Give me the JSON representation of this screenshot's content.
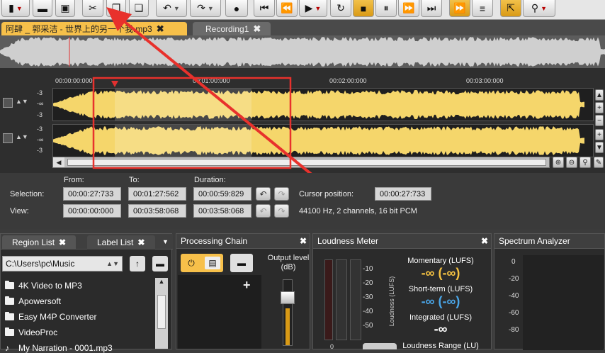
{
  "tabs": [
    {
      "label": "阿肆 _ 郭采洁 - 世界上的另一个我.mp3"
    },
    {
      "label": "Recording1"
    }
  ],
  "ruler": [
    "00:00:00:000",
    "00:01:00:000",
    "00:02:00:000",
    "00:03:00:000"
  ],
  "channel_db": [
    "-3",
    "-∞",
    "-3"
  ],
  "selection_panel": {
    "from_label": "From:",
    "to_label": "To:",
    "duration_label": "Duration:",
    "selection_label": "Selection:",
    "view_label": "View:",
    "selection_from": "00:00:27:733",
    "selection_to": "00:01:27:562",
    "selection_duration": "00:00:59:829",
    "view_from": "00:00:00:000",
    "view_to": "00:03:58:068",
    "view_duration": "00:03:58:068",
    "cursor_label": "Cursor position:",
    "cursor_value": "00:00:27:733",
    "format_info": "44100 Hz, 2 channels, 16 bit PCM"
  },
  "region_panel": {
    "tab_region": "Region List",
    "tab_label": "Label List",
    "path": "C:\\Users\\pc\\Music",
    "folders": [
      "4K Video to MP3",
      "Apowersoft",
      "Easy M4P Converter",
      "VideoProc",
      "My Narration - 0001.mp3"
    ]
  },
  "processing_chain": {
    "title": "Processing Chain",
    "output_label": "Output level (dB)"
  },
  "loudness": {
    "title": "Loudness Meter",
    "scale": [
      "-10",
      "-20",
      "-30",
      "-40",
      "-50"
    ],
    "axis_label": "Loudness (LUFS)",
    "zero": "0",
    "momentary_label": "Momentary (LUFS)",
    "momentary_value": "-∞ (-∞)",
    "shortterm_label": "Short-term (LUFS)",
    "shortterm_value": "-∞ (-∞)",
    "integrated_label": "Integrated (LUFS)",
    "integrated_value": "-∞",
    "range_label": "Loudness Range (LU)"
  },
  "spectrum": {
    "title": "Spectrum Analyzer",
    "scale": [
      "0",
      "-20",
      "-40",
      "-60",
      "-80"
    ]
  },
  "colors": {
    "accent": "#f7c04a",
    "waveform": "#f5d66b",
    "annotation": "#e8312c"
  }
}
